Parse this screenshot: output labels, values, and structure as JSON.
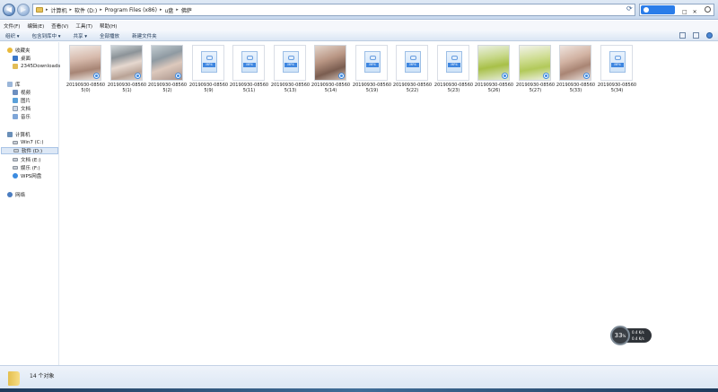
{
  "address_bar": {
    "breadcrumbs": [
      "计算机",
      "软件 (D:)",
      "Program Files (x86)",
      "u盘",
      "佛萨"
    ]
  },
  "window_controls": "□ ✕",
  "menu": [
    "文件(F)",
    "编辑(E)",
    "查看(V)",
    "工具(T)",
    "帮助(H)"
  ],
  "toolbar": [
    "组织 ▾",
    "包含到库中 ▾",
    "共享 ▾",
    "全部播放",
    "新建文件夹"
  ],
  "nav": {
    "favorites": {
      "label": "收藏夹",
      "items": [
        "桌面",
        "2345Downloads"
      ]
    },
    "libraries": {
      "label": "库",
      "items": [
        "视频",
        "图片",
        "文档",
        "音乐"
      ]
    },
    "computer": {
      "label": "计算机",
      "items": [
        "Win7 (C:)",
        "软件 (D:)",
        "文档 (E:)",
        "娱乐 (F:)",
        "WPS网盘"
      ]
    },
    "network": {
      "label": "网络"
    }
  },
  "files": [
    {
      "name": "20190930-085605(0)",
      "kind": "photo"
    },
    {
      "name": "20190930-085605(1)",
      "kind": "photo"
    },
    {
      "name": "20190930-085605(2)",
      "kind": "photo"
    },
    {
      "name": "20190930-085605(9)",
      "kind": "mp4"
    },
    {
      "name": "20190930-085605(11)",
      "kind": "mp4"
    },
    {
      "name": "20190930-085605(13)",
      "kind": "mp4"
    },
    {
      "name": "20190930-085605(14)",
      "kind": "photo"
    },
    {
      "name": "20190930-085605(19)",
      "kind": "mp4"
    },
    {
      "name": "20190930-085605(22)",
      "kind": "mp4"
    },
    {
      "name": "20190930-085605(23)",
      "kind": "mp4"
    },
    {
      "name": "20190930-085605(26)",
      "kind": "photo"
    },
    {
      "name": "20190930-085605(27)",
      "kind": "photo"
    },
    {
      "name": "20190930-085605(33)",
      "kind": "photo"
    },
    {
      "name": "20190930-085605(34)",
      "kind": "mp4"
    }
  ],
  "file_type_label": "MP4",
  "speed_widget": {
    "percent": "33",
    "percent_unit": "%",
    "up": "0.4",
    "up_unit": "K/s",
    "down": "0.4",
    "down_unit": "K/s"
  },
  "status": {
    "item_count": "14 个对象"
  }
}
